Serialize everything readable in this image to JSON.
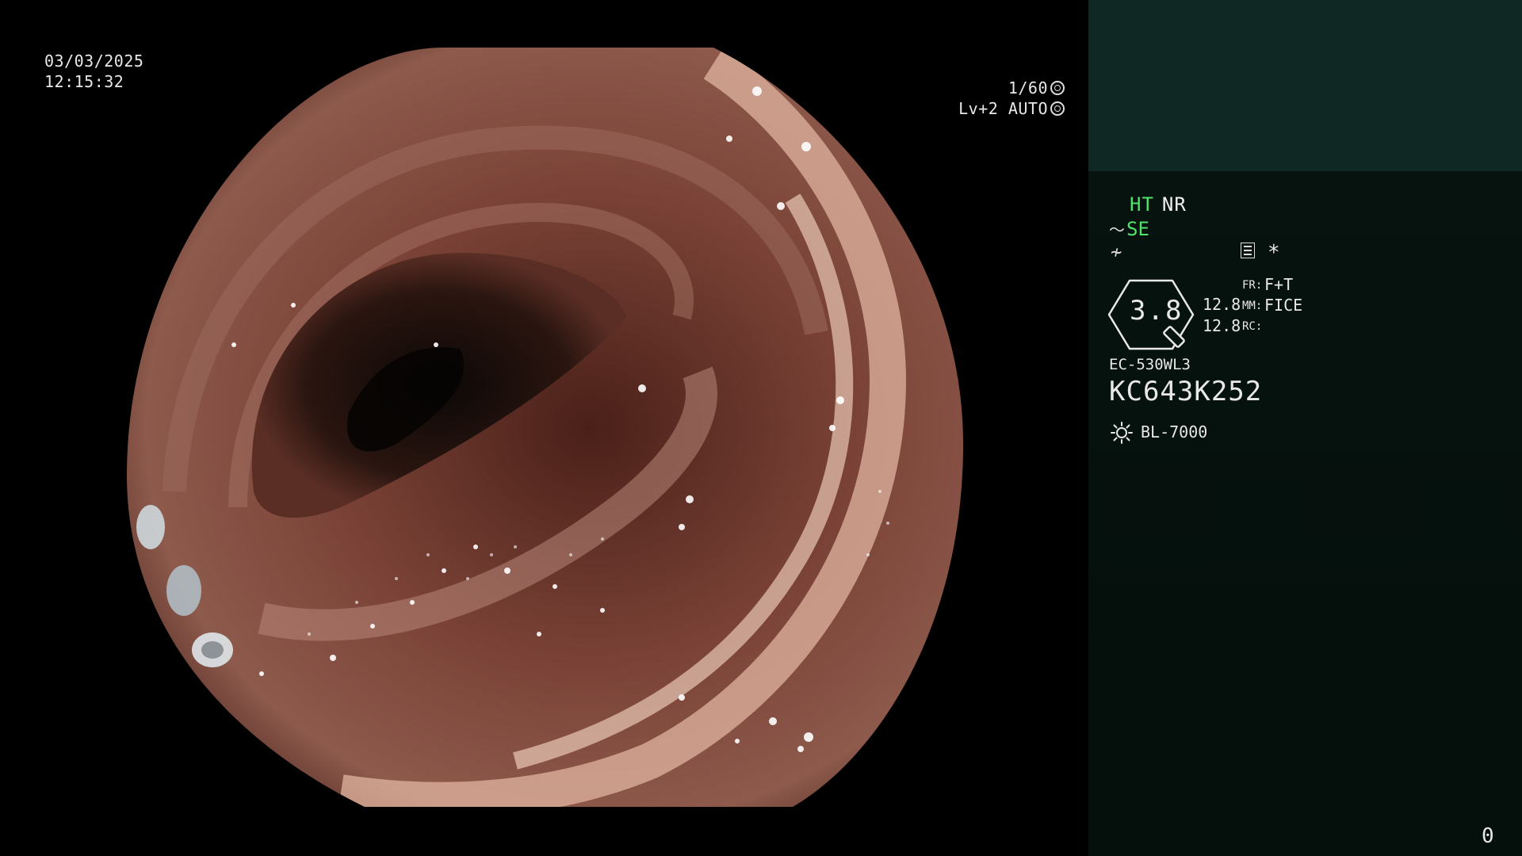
{
  "overlay": {
    "date": "03/03/2025",
    "time": "12:15:32",
    "shutter": "1/60",
    "iris": "Lv+2 AUTO"
  },
  "panel": {
    "mode_ht": "HT",
    "mode_nr": "NR",
    "se": "SE",
    "star": "*",
    "dial_value": "3.8",
    "value_1": "12.8",
    "value_2": "12.8",
    "fr_label": "FR:",
    "fr_value": "F+T",
    "mm_label": "MM:",
    "mm_value": "FICE",
    "rc_label": "RC:",
    "scope_model": "EC-530WL3",
    "scope_serial": "KC643K252",
    "light_source": "BL-7000",
    "counter": "0"
  },
  "colors": {
    "panel_bg": "#06140f",
    "panel_header_bg": "#0f2823",
    "active_green": "#4fe36a",
    "text": "#e8e8e8"
  },
  "icons": [
    "shutter-icon",
    "iris-icon",
    "wave-icon",
    "ne-icon",
    "menu-icon",
    "scope-dial-icon",
    "sun-icon"
  ]
}
